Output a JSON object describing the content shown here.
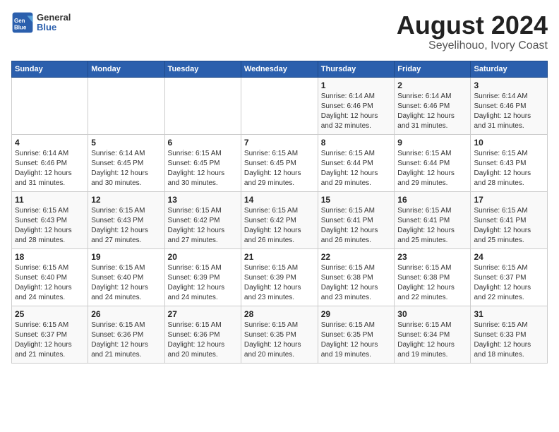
{
  "header": {
    "logo": {
      "general": "General",
      "blue": "Blue"
    },
    "title": "August 2024",
    "subtitle": "Seyelihouo, Ivory Coast"
  },
  "calendar": {
    "days_of_week": [
      "Sunday",
      "Monday",
      "Tuesday",
      "Wednesday",
      "Thursday",
      "Friday",
      "Saturday"
    ],
    "weeks": [
      [
        {
          "day": "",
          "info": ""
        },
        {
          "day": "",
          "info": ""
        },
        {
          "day": "",
          "info": ""
        },
        {
          "day": "",
          "info": ""
        },
        {
          "day": "1",
          "info": "Sunrise: 6:14 AM\nSunset: 6:46 PM\nDaylight: 12 hours\nand 32 minutes."
        },
        {
          "day": "2",
          "info": "Sunrise: 6:14 AM\nSunset: 6:46 PM\nDaylight: 12 hours\nand 31 minutes."
        },
        {
          "day": "3",
          "info": "Sunrise: 6:14 AM\nSunset: 6:46 PM\nDaylight: 12 hours\nand 31 minutes."
        }
      ],
      [
        {
          "day": "4",
          "info": "Sunrise: 6:14 AM\nSunset: 6:46 PM\nDaylight: 12 hours\nand 31 minutes."
        },
        {
          "day": "5",
          "info": "Sunrise: 6:14 AM\nSunset: 6:45 PM\nDaylight: 12 hours\nand 30 minutes."
        },
        {
          "day": "6",
          "info": "Sunrise: 6:15 AM\nSunset: 6:45 PM\nDaylight: 12 hours\nand 30 minutes."
        },
        {
          "day": "7",
          "info": "Sunrise: 6:15 AM\nSunset: 6:45 PM\nDaylight: 12 hours\nand 29 minutes."
        },
        {
          "day": "8",
          "info": "Sunrise: 6:15 AM\nSunset: 6:44 PM\nDaylight: 12 hours\nand 29 minutes."
        },
        {
          "day": "9",
          "info": "Sunrise: 6:15 AM\nSunset: 6:44 PM\nDaylight: 12 hours\nand 29 minutes."
        },
        {
          "day": "10",
          "info": "Sunrise: 6:15 AM\nSunset: 6:43 PM\nDaylight: 12 hours\nand 28 minutes."
        }
      ],
      [
        {
          "day": "11",
          "info": "Sunrise: 6:15 AM\nSunset: 6:43 PM\nDaylight: 12 hours\nand 28 minutes."
        },
        {
          "day": "12",
          "info": "Sunrise: 6:15 AM\nSunset: 6:43 PM\nDaylight: 12 hours\nand 27 minutes."
        },
        {
          "day": "13",
          "info": "Sunrise: 6:15 AM\nSunset: 6:42 PM\nDaylight: 12 hours\nand 27 minutes."
        },
        {
          "day": "14",
          "info": "Sunrise: 6:15 AM\nSunset: 6:42 PM\nDaylight: 12 hours\nand 26 minutes."
        },
        {
          "day": "15",
          "info": "Sunrise: 6:15 AM\nSunset: 6:41 PM\nDaylight: 12 hours\nand 26 minutes."
        },
        {
          "day": "16",
          "info": "Sunrise: 6:15 AM\nSunset: 6:41 PM\nDaylight: 12 hours\nand 25 minutes."
        },
        {
          "day": "17",
          "info": "Sunrise: 6:15 AM\nSunset: 6:41 PM\nDaylight: 12 hours\nand 25 minutes."
        }
      ],
      [
        {
          "day": "18",
          "info": "Sunrise: 6:15 AM\nSunset: 6:40 PM\nDaylight: 12 hours\nand 24 minutes."
        },
        {
          "day": "19",
          "info": "Sunrise: 6:15 AM\nSunset: 6:40 PM\nDaylight: 12 hours\nand 24 minutes."
        },
        {
          "day": "20",
          "info": "Sunrise: 6:15 AM\nSunset: 6:39 PM\nDaylight: 12 hours\nand 24 minutes."
        },
        {
          "day": "21",
          "info": "Sunrise: 6:15 AM\nSunset: 6:39 PM\nDaylight: 12 hours\nand 23 minutes."
        },
        {
          "day": "22",
          "info": "Sunrise: 6:15 AM\nSunset: 6:38 PM\nDaylight: 12 hours\nand 23 minutes."
        },
        {
          "day": "23",
          "info": "Sunrise: 6:15 AM\nSunset: 6:38 PM\nDaylight: 12 hours\nand 22 minutes."
        },
        {
          "day": "24",
          "info": "Sunrise: 6:15 AM\nSunset: 6:37 PM\nDaylight: 12 hours\nand 22 minutes."
        }
      ],
      [
        {
          "day": "25",
          "info": "Sunrise: 6:15 AM\nSunset: 6:37 PM\nDaylight: 12 hours\nand 21 minutes."
        },
        {
          "day": "26",
          "info": "Sunrise: 6:15 AM\nSunset: 6:36 PM\nDaylight: 12 hours\nand 21 minutes."
        },
        {
          "day": "27",
          "info": "Sunrise: 6:15 AM\nSunset: 6:36 PM\nDaylight: 12 hours\nand 20 minutes."
        },
        {
          "day": "28",
          "info": "Sunrise: 6:15 AM\nSunset: 6:35 PM\nDaylight: 12 hours\nand 20 minutes."
        },
        {
          "day": "29",
          "info": "Sunrise: 6:15 AM\nSunset: 6:35 PM\nDaylight: 12 hours\nand 19 minutes."
        },
        {
          "day": "30",
          "info": "Sunrise: 6:15 AM\nSunset: 6:34 PM\nDaylight: 12 hours\nand 19 minutes."
        },
        {
          "day": "31",
          "info": "Sunrise: 6:15 AM\nSunset: 6:33 PM\nDaylight: 12 hours\nand 18 minutes."
        }
      ]
    ]
  }
}
